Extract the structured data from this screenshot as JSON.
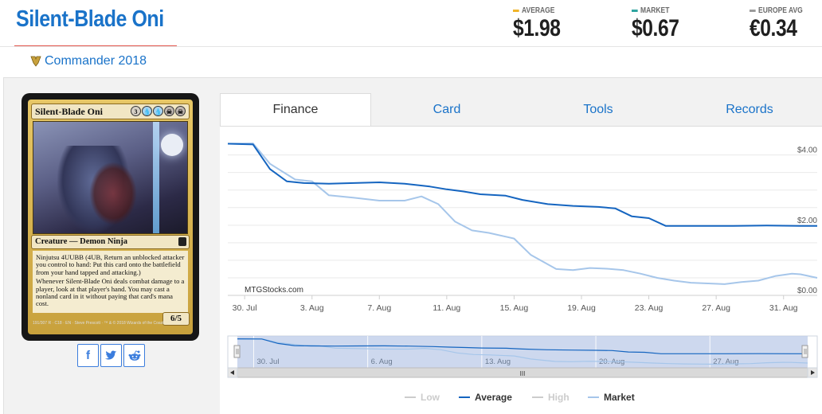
{
  "card": {
    "title": "Silent-Blade Oni",
    "set_name": "Commander 2018"
  },
  "prices": {
    "average": {
      "label": "AVERAGE",
      "value": "$1.98",
      "color": "#f0b429"
    },
    "market": {
      "label": "MARKET",
      "value": "$0.67",
      "color": "#2fa5a0"
    },
    "europe": {
      "label": "EUROPE AVG",
      "value": "€0.34",
      "color": "#9a9a9a"
    }
  },
  "card_image": {
    "name": "Silent-Blade Oni",
    "mana": [
      "3",
      "U",
      "U",
      "B",
      "B"
    ],
    "type_line": "Creature — Demon Ninja",
    "ninjutsu": "Ninjutsu 4UUBB (4UB, Return an unblocked attacker you control to hand: Put this card onto the battlefield from your hand tapped and attacking.)",
    "ability": "Whenever Silent-Blade Oni deals combat damage to a player, look at that player's hand. You may cast a nonland card in it without paying that card's mana cost.",
    "pt": "6/5",
    "footer": "191/307 R · C18 · EN · Steve Prescott · ™ & © 2018 Wizards of the Coast"
  },
  "share": {
    "facebook": "f",
    "twitter_icon": "twitter-icon",
    "reddit_icon": "reddit-icon"
  },
  "tabs": [
    "Finance",
    "Card",
    "Tools",
    "Records"
  ],
  "active_tab": "Finance",
  "chart_data": {
    "type": "line",
    "watermark": "MTGStocks.com",
    "x_ticks": [
      "30. Jul",
      "3. Aug",
      "7. Aug",
      "11. Aug",
      "15. Aug",
      "19. Aug",
      "23. Aug",
      "27. Aug",
      "31. Aug"
    ],
    "y_ticks": [
      "$4.00",
      "$2.00",
      "$0.00"
    ],
    "ylim": [
      0,
      4.4
    ],
    "x_start_day": 29,
    "series": [
      {
        "name": "Average",
        "color": "#1565c0",
        "values": [
          [
            29.0,
            4.32
          ],
          [
            30.5,
            4.3
          ],
          [
            31.5,
            3.6
          ],
          [
            32.5,
            3.25
          ],
          [
            33.5,
            3.2
          ],
          [
            35.0,
            3.18
          ],
          [
            36.5,
            3.2
          ],
          [
            38.0,
            3.22
          ],
          [
            39.5,
            3.18
          ],
          [
            41.0,
            3.1
          ],
          [
            42.0,
            3.02
          ],
          [
            43.0,
            2.96
          ],
          [
            44.0,
            2.88
          ],
          [
            45.5,
            2.84
          ],
          [
            46.5,
            2.72
          ],
          [
            48.0,
            2.6
          ],
          [
            49.5,
            2.55
          ],
          [
            51.0,
            2.52
          ],
          [
            52.0,
            2.48
          ],
          [
            53.0,
            2.25
          ],
          [
            54.0,
            2.2
          ],
          [
            55.0,
            1.98
          ],
          [
            57.0,
            1.98
          ],
          [
            59.0,
            1.98
          ],
          [
            61.0,
            1.99
          ],
          [
            63.0,
            1.98
          ],
          [
            64.0,
            1.98
          ]
        ]
      },
      {
        "name": "Market",
        "color": "#a6c6ea",
        "values": [
          [
            29.0,
            4.32
          ],
          [
            30.5,
            4.33
          ],
          [
            31.5,
            3.75
          ],
          [
            32.5,
            3.45
          ],
          [
            33.0,
            3.3
          ],
          [
            34.0,
            3.25
          ],
          [
            35.0,
            2.85
          ],
          [
            36.5,
            2.78
          ],
          [
            38.0,
            2.7
          ],
          [
            39.5,
            2.7
          ],
          [
            40.5,
            2.82
          ],
          [
            41.5,
            2.6
          ],
          [
            42.5,
            2.1
          ],
          [
            43.5,
            1.85
          ],
          [
            44.5,
            1.78
          ],
          [
            46.0,
            1.62
          ],
          [
            47.0,
            1.15
          ],
          [
            48.5,
            0.75
          ],
          [
            49.5,
            0.72
          ],
          [
            50.5,
            0.78
          ],
          [
            51.5,
            0.76
          ],
          [
            52.5,
            0.72
          ],
          [
            53.5,
            0.62
          ],
          [
            54.5,
            0.5
          ],
          [
            55.5,
            0.42
          ],
          [
            56.5,
            0.36
          ],
          [
            57.5,
            0.34
          ],
          [
            58.5,
            0.32
          ],
          [
            59.5,
            0.38
          ],
          [
            60.5,
            0.42
          ],
          [
            61.5,
            0.55
          ],
          [
            62.5,
            0.62
          ],
          [
            63.0,
            0.6
          ],
          [
            64.0,
            0.5
          ]
        ]
      }
    ],
    "navigator_ticks": [
      "30. Jul",
      "6. Aug",
      "13. Aug",
      "20. Aug",
      "27. Aug"
    ],
    "legend": [
      {
        "name": "Low",
        "color": "#dddddd",
        "enabled": false
      },
      {
        "name": "Average",
        "color": "#1565c0",
        "enabled": true
      },
      {
        "name": "High",
        "color": "#dddddd",
        "enabled": false
      },
      {
        "name": "Market",
        "color": "#a6c6ea",
        "enabled": true
      }
    ],
    "scroll_thumb_label": "III"
  }
}
